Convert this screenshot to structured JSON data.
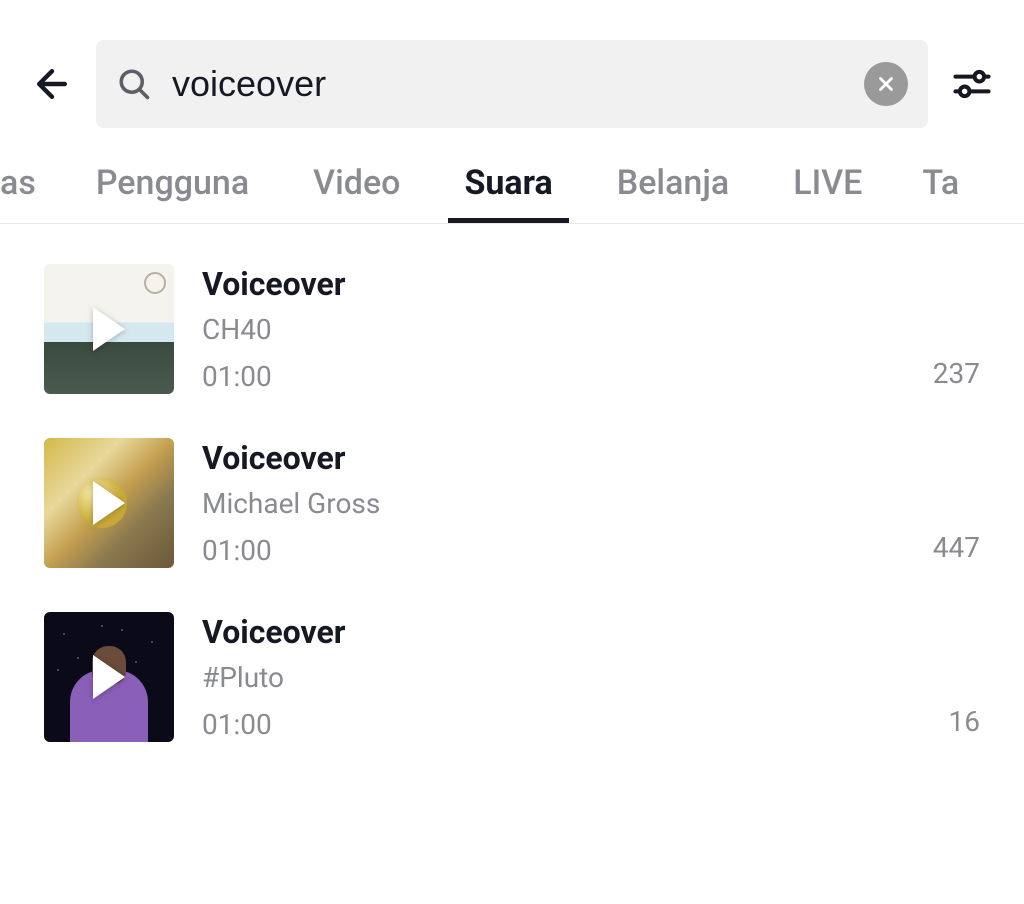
{
  "search": {
    "value": "voiceover"
  },
  "tabs": {
    "partial_left": "as",
    "items": [
      "Pengguna",
      "Video",
      "Suara",
      "Belanja",
      "LIVE"
    ],
    "partial_right": "Ta",
    "active_index": 2
  },
  "results": [
    {
      "title": "Voiceover",
      "artist": "CH40",
      "duration": "01:00",
      "count": "237"
    },
    {
      "title": "Voiceover",
      "artist": "Michael Gross",
      "duration": "01:00",
      "count": "447"
    },
    {
      "title": "Voiceover",
      "artist": "#Pluto",
      "duration": "01:00",
      "count": "16"
    }
  ]
}
